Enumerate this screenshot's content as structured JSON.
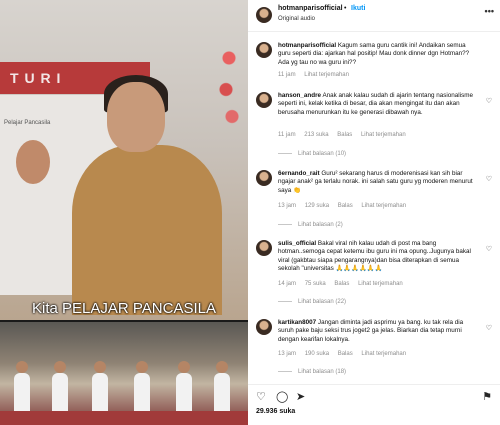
{
  "post": {
    "username": "hotmanparisofficial",
    "separator": "•",
    "follow_label": "Ikuti",
    "audio": "Original audio",
    "more_icon": "more-horizontal-icon",
    "video_caption": "Kita PELAJAR PANCASILA",
    "banner_text": "T U R I",
    "board_text": "Pelajar Pancasila",
    "likes": "29.936 suka"
  },
  "caption": {
    "username": "hotmanparisofficial",
    "text": "Kagum sama guru cantik ini! Andaikan semua guru seperti dia: ajarkan hal positip! Mau donk dinner dgn Hotman?? Ada yg tau no wa guru ini??",
    "time": "11 jam",
    "translate": "Lihat terjemahan"
  },
  "comments": [
    {
      "username": "hanson_andre",
      "text": "Anak anak kalau sudah di ajarin tentang nasionalisme seperti ini, kelak ketika di besar, dia akan mengingat itu dan akan berusaha menurunkan itu ke generasi dibawah nya.",
      "time": "11 jam",
      "likes": "213 suka",
      "reply": "Balas",
      "translate": "Lihat terjemahan",
      "view_replies": "Lihat balasan (10)"
    },
    {
      "username": "6ernando_rait",
      "text": "Guru² sekarang harus di moderenisasi kan sih biar ngajar anak² ga terlalu norak. ini salah satu guru yg moderen menurut saya 👏",
      "time": "13 jam",
      "likes": "129 suka",
      "reply": "Balas",
      "translate": "Lihat terjemahan",
      "view_replies": "Lihat balasan (2)"
    },
    {
      "username": "sulis_official",
      "text": "Bakal viral nih kalau udah di post ma bang hotman..semoga cepat ketemu ibu guru ini ma opung..Jugunya bakal viral (gakbtau siapa pengarangnya)dan bisa diterapkan di semua sekolah \"universitas 🙏🙏🙏🙏🙏🙏",
      "time": "14 jam",
      "likes": "75 suka",
      "reply": "Balas",
      "translate": "Lihat terjemahan",
      "view_replies": "Lihat balasan (22)"
    },
    {
      "username": "kartikan8007",
      "text": "Jangan diminta jadi asprimu ya bang. ku tak rela dia suruh pake baju seksi trus joget2 ga jelas. Biarkan dia tetap murni dengan kearifan lokalnya.",
      "time": "13 jam",
      "likes": "190 suka",
      "reply": "Balas",
      "translate": "Lihat terjemahan",
      "view_replies": "Lihat balasan (18)"
    }
  ],
  "actions": {
    "like_icon": "heart-icon",
    "comment_icon": "comment-icon",
    "share_icon": "share-icon",
    "save_icon": "bookmark-icon"
  }
}
